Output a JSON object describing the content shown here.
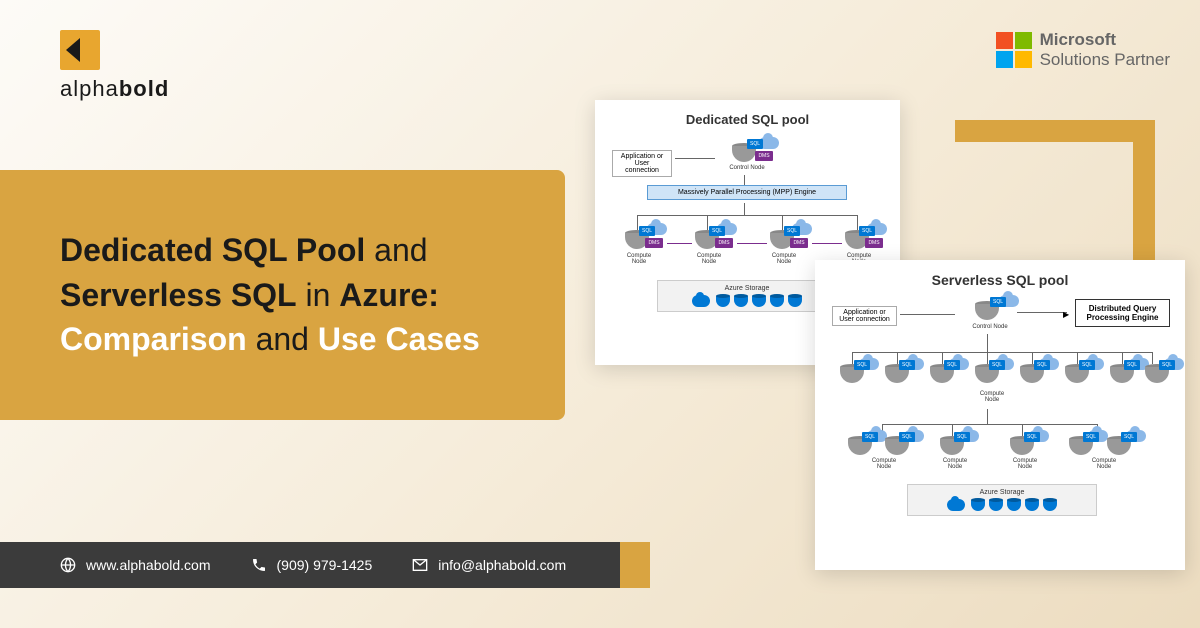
{
  "logo": {
    "brand_part1": "alpha",
    "brand_part2": "bold"
  },
  "partner": {
    "name": "Microsoft",
    "subtitle": "Solutions Partner"
  },
  "headline": {
    "part1": "Dedicated SQL Pool",
    "conj1": "and",
    "part2": "Serverless SQL",
    "conj2": "in",
    "part3": "Azure:",
    "part4": "Comparison",
    "conj3": "and",
    "part5": "Use Cases"
  },
  "diagram1": {
    "title": "Dedicated SQL pool",
    "app_label": "Application or\nUser connection",
    "control_node": "Control Node",
    "mpp": "Massively Parallel Processing (MPP) Engine",
    "compute": "Compute\nNode",
    "storage": "Azure Storage",
    "sql": "SQL",
    "dms": "DMS"
  },
  "diagram2": {
    "title": "Serverless SQL pool",
    "app_label": "Application or\nUser connection",
    "control_node": "Control Node",
    "dqp": "Distributed Query\nProcessing Engine",
    "compute": "Compute\nNode",
    "storage": "Azure Storage",
    "sql": "SQL"
  },
  "footer": {
    "website": "www.alphabold.com",
    "phone": "(909) 979-1425",
    "email": "info@alphabold.com"
  }
}
